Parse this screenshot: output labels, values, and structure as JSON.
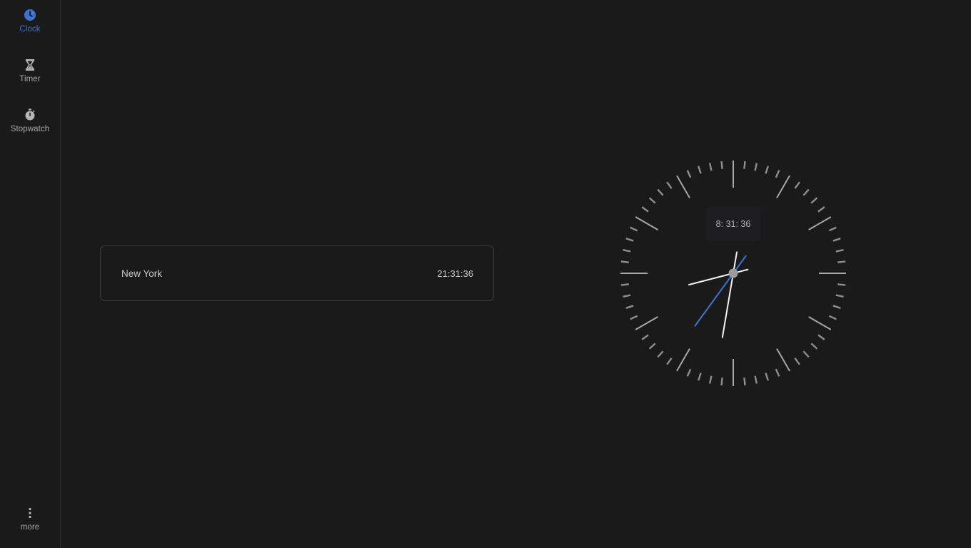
{
  "sidebar": {
    "items": [
      {
        "label": "Clock",
        "icon": "clock-icon",
        "active": true
      },
      {
        "label": "Timer",
        "icon": "hourglass-icon",
        "active": false
      },
      {
        "label": "Stopwatch",
        "icon": "stopwatch-icon",
        "active": false
      }
    ],
    "more": {
      "label": "more",
      "icon": "vertical-dots-icon"
    }
  },
  "world_clocks": [
    {
      "city": "New York",
      "time": "21:31:36"
    }
  ],
  "analog_clock": {
    "digital_readout": "8: 31: 36",
    "hours": 8,
    "minutes": 31,
    "seconds": 36
  },
  "colors": {
    "background": "#1a1a1b",
    "accent": "#3d73d4",
    "text": "#c8c8ca",
    "tick": "#8e8e90",
    "hand": "#f2f2f2",
    "second_hand": "#3d73d4"
  }
}
